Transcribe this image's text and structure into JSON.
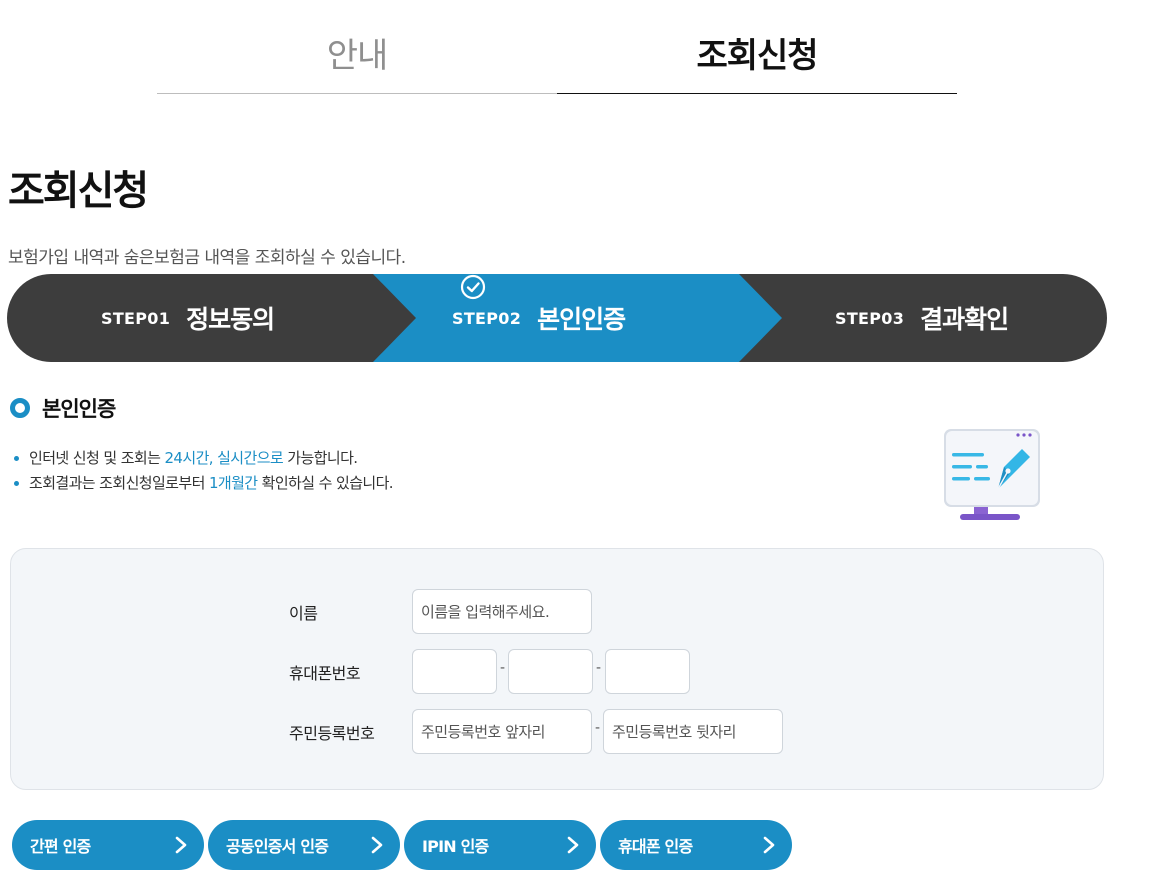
{
  "tabs": [
    {
      "label": "안내",
      "active": false
    },
    {
      "label": "조회신청",
      "active": true
    }
  ],
  "page": {
    "title": "조회신청",
    "description": "보험가입 내역과 숨은보험금 내역을 조회하실 수 있습니다."
  },
  "steps": [
    {
      "no": "STEP01",
      "name": "정보동의"
    },
    {
      "no": "STEP02",
      "name": "본인인증",
      "icon": "check-circle-icon"
    },
    {
      "no": "STEP03",
      "name": "결과확인"
    }
  ],
  "section": {
    "title": "본인인증",
    "bullets": [
      {
        "pre": "인터넷 신청 및 조회는 ",
        "hl": "24시간, 실시간으로",
        "post": " 가능합니다."
      },
      {
        "pre": "조회결과는 조회신청일로부터 ",
        "hl": "1개월간",
        "post": " 확인하실 수 있습니다."
      }
    ],
    "illustration": "monitor-pen-icon"
  },
  "form": {
    "name_label": "이름",
    "name_placeholder": "이름을 입력해주세요.",
    "phone_label": "휴대폰번호",
    "phone_sep": "-",
    "rrn_label": "주민등록번호",
    "rrn_front_placeholder": "주민등록번호 앞자리",
    "rrn_back_placeholder": "주민등록번호 뒷자리",
    "rrn_sep": "-"
  },
  "auth_buttons": [
    {
      "label": "간편 인증"
    },
    {
      "label": "공동인증서 인증"
    },
    {
      "label": "IPIN 인증"
    },
    {
      "label": "휴대폰 인증"
    }
  ],
  "colors": {
    "accent": "#1b8ec5",
    "step_dark": "#3d3d3d",
    "form_bg": "#f3f6f9"
  }
}
